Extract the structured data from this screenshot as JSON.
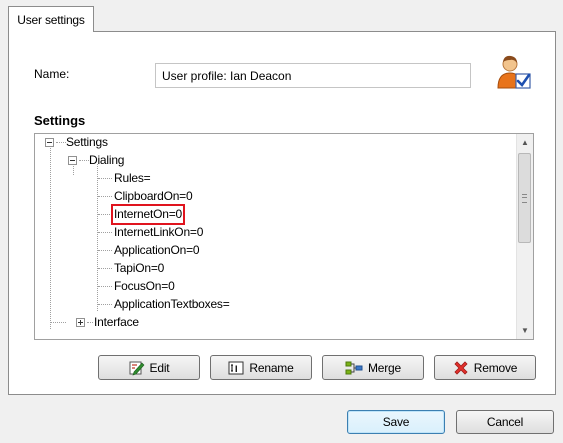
{
  "tabs": [
    {
      "label": "User settings"
    }
  ],
  "name": {
    "label": "Name:",
    "value": "User profile: Ian Deacon"
  },
  "icons": {
    "user": "user-check-icon",
    "edit": "edit-icon",
    "rename": "rename-icon",
    "merge": "merge-icon",
    "remove": "remove-icon"
  },
  "settings": {
    "heading": "Settings",
    "tree": {
      "root": "Settings",
      "dialing": "Dialing",
      "dialing_items": [
        "Rules=",
        "ClipboardOn=0",
        "InternetOn=0",
        "InternetLinkOn=0",
        "ApplicationOn=0",
        "TapiOn=0",
        "FocusOn=0",
        "ApplicationTextboxes="
      ],
      "interface": "Interface",
      "highlighted_item": "InternetOn=0"
    }
  },
  "actions": {
    "edit": "Edit",
    "rename": "Rename",
    "merge": "Merge",
    "remove": "Remove"
  },
  "footer": {
    "save": "Save",
    "cancel": "Cancel"
  },
  "colors": {
    "highlight": "#e0141e",
    "primary_border": "#3c7fb1"
  }
}
